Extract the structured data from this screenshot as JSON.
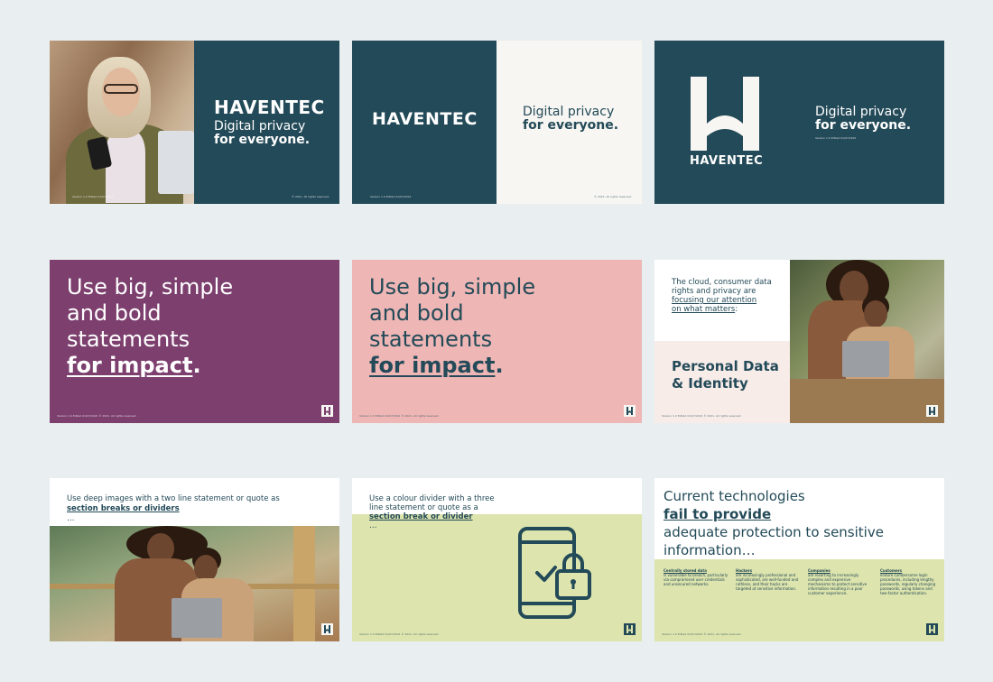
{
  "brand": {
    "name": "HAVENTEC",
    "tagline_line1": "Digital privacy",
    "tagline_line2": "for everyone."
  },
  "footer": {
    "version": "Version 1.0 Edited 01/07/2021",
    "copyright": "© 2021. All rights reserved."
  },
  "statement": {
    "line1": "Use big, simple",
    "line2": "and bold",
    "line3": "statements",
    "emphasis": "for impact",
    "period": "."
  },
  "personal_data": {
    "intro_line1": "The cloud, consumer data",
    "intro_line2": "rights and privacy are",
    "intro_link1": "focusing our attention",
    "intro_link2": "on what matters",
    "intro_colon": ":",
    "title_line1": "Personal Data",
    "title_line2": "& Identity"
  },
  "section_break": {
    "line1": "Use deep images with a two line statement or quote as",
    "link": "section breaks or dividers",
    "suffix": "…"
  },
  "colour_divider": {
    "line1": "Use a colour divider with a three",
    "line2": "line statement or quote as a",
    "link": "section break or divider",
    "suffix": "…"
  },
  "current_tech": {
    "line1_pre": "Current technologies ",
    "line1_link": "fail to provide",
    "line2": "adequate protection to sensitive",
    "line3": "information…",
    "columns": [
      {
        "heading": "Centrally stored data",
        "body": "is vulnerable to breach, particularly via compromised user credentials and unsecured networks."
      },
      {
        "heading": "Hackers",
        "body": "are increasingly professional and sophisticated, are well-funded and ruthless, and their hacks are targeted at sensitive information."
      },
      {
        "heading": "Companies",
        "body": "are resorting to increasingly complex and expensive mechanisms to protect sensitive information resulting in a poor customer experience."
      },
      {
        "heading": "Customers",
        "body": "endure cumbersome login procedures, including lengthy passwords, regularly changing passwords, using tokens and two-factor authentication."
      }
    ]
  },
  "colors": {
    "teal": "#234a58",
    "cream": "#f7f6f2",
    "purple": "#7c3f6e",
    "pink": "#eeb6b5",
    "green": "#dde4ad",
    "blush": "#f8ece9"
  },
  "icons": {
    "logo": "haventec-h-logo-icon",
    "phone_lock": "phone-check-lock-icon"
  }
}
